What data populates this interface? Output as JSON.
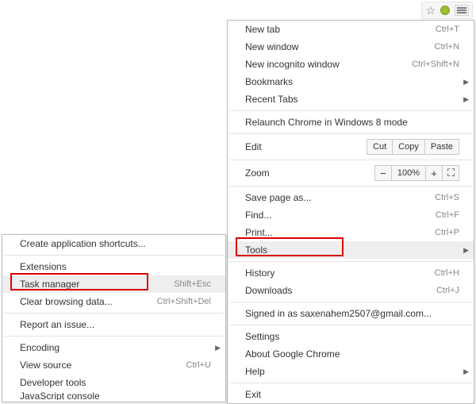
{
  "menu": {
    "new_tab": {
      "label": "New tab",
      "shortcut": "Ctrl+T"
    },
    "new_window": {
      "label": "New window",
      "shortcut": "Ctrl+N"
    },
    "new_incognito": {
      "label": "New incognito window",
      "shortcut": "Ctrl+Shift+N"
    },
    "bookmarks": {
      "label": "Bookmarks"
    },
    "recent_tabs": {
      "label": "Recent Tabs"
    },
    "relaunch": {
      "label": "Relaunch Chrome in Windows 8 mode"
    },
    "edit": {
      "label": "Edit",
      "cut": "Cut",
      "copy": "Copy",
      "paste": "Paste"
    },
    "zoom": {
      "label": "Zoom",
      "value": "100%"
    },
    "save_as": {
      "label": "Save page as...",
      "shortcut": "Ctrl+S"
    },
    "find": {
      "label": "Find...",
      "shortcut": "Ctrl+F"
    },
    "print": {
      "label": "Print...",
      "shortcut": "Ctrl+P"
    },
    "tools": {
      "label": "Tools"
    },
    "history": {
      "label": "History",
      "shortcut": "Ctrl+H"
    },
    "downloads": {
      "label": "Downloads",
      "shortcut": "Ctrl+J"
    },
    "signed_in": {
      "label": "Signed in as saxenahem2507@gmail.com..."
    },
    "settings": {
      "label": "Settings"
    },
    "about": {
      "label": "About Google Chrome"
    },
    "help": {
      "label": "Help"
    },
    "exit": {
      "label": "Exit"
    }
  },
  "submenu": {
    "create_shortcuts": {
      "label": "Create application shortcuts..."
    },
    "extensions": {
      "label": "Extensions"
    },
    "task_manager": {
      "label": "Task manager",
      "shortcut": "Shift+Esc"
    },
    "clear_data": {
      "label": "Clear browsing data...",
      "shortcut": "Ctrl+Shift+Del"
    },
    "report_issue": {
      "label": "Report an issue..."
    },
    "encoding": {
      "label": "Encoding"
    },
    "view_source": {
      "label": "View source",
      "shortcut": "Ctrl+U"
    },
    "dev_tools": {
      "label": "Developer tools"
    },
    "js_console": {
      "label": "JavaScript console"
    }
  }
}
